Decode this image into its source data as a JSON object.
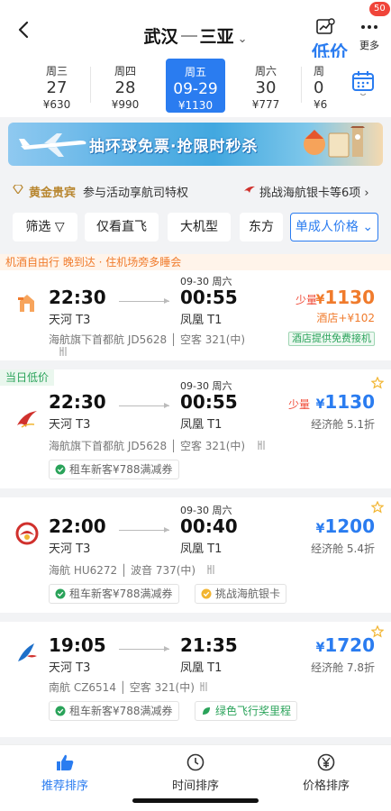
{
  "header": {
    "origin": "武汉",
    "destination": "三亚",
    "price_alert_label": "低价提醒",
    "more_label": "更多",
    "badge_count": "50"
  },
  "dates": [
    {
      "weekday": "周三",
      "day": "27",
      "price": "¥630"
    },
    {
      "weekday": "周四",
      "day": "28",
      "price": "¥990"
    },
    {
      "weekday": "周五",
      "day": "09-29",
      "price": "¥1130",
      "selected": true
    },
    {
      "weekday": "周六",
      "day": "30",
      "price": "¥777"
    },
    {
      "weekday": "周",
      "day": "0",
      "price": "¥6"
    }
  ],
  "banner": {
    "text": "抽环球免票·抢限时秒杀"
  },
  "vip": {
    "tier": "黄金贵宾",
    "activity": "参与活动享航司特权",
    "challenge": "挑战海航银卡等6项"
  },
  "filters": [
    {
      "label": "筛选"
    },
    {
      "label": "仅看直飞"
    },
    {
      "label": "大机型"
    },
    {
      "label": "东方航"
    },
    {
      "label": "单成人价格"
    }
  ],
  "flights": [
    {
      "tag": "机酒自由行  晚到达 · 住机场旁多睡会",
      "dep_time": "22:30",
      "dep_airport": "天河 T3",
      "arr_time": "00:55",
      "arr_airport": "凤凰 T1",
      "arr_date": "09-30 周六",
      "info": "海航旗下首都航 JD5628 │ 空客 321(中)",
      "few_label": "少量",
      "price": "1130",
      "hotel_plus": "酒店+¥102",
      "pickup": "酒店提供免费接机",
      "style": "orange"
    },
    {
      "tag": "当日低价",
      "dep_time": "22:30",
      "dep_airport": "天河 T3",
      "arr_time": "00:55",
      "arr_airport": "凤凰 T1",
      "arr_date": "09-30 周六",
      "info": "海航旗下首都航 JD5628 │ 空客 321(中)",
      "few_label": "少量",
      "price": "1130",
      "cabin": "经济舱 5.1折",
      "coupons": [
        "租车新客¥788满减券"
      ]
    },
    {
      "dep_time": "22:00",
      "dep_airport": "天河 T3",
      "arr_time": "00:40",
      "arr_airport": "凤凰 T1",
      "arr_date": "09-30 周六",
      "info": "海航 HU6272 │ 波音 737(中)",
      "price": "1200",
      "cabin": "经济舱 5.4折",
      "coupons": [
        "租车新客¥788满减券",
        "挑战海航银卡"
      ]
    },
    {
      "dep_time": "19:05",
      "dep_airport": "天河 T3",
      "arr_time": "21:35",
      "arr_airport": "凤凰 T1",
      "info": "南航 CZ6514 │ 空客 321(中)",
      "price": "1720",
      "cabin": "经济舱 7.8折",
      "coupons": [
        "租车新客¥788满减券",
        "绿色飞行奖里程"
      ]
    }
  ],
  "bottom_nav": [
    {
      "label": "推荐排序",
      "active": true
    },
    {
      "label": "时间排序"
    },
    {
      "label": "价格排序"
    }
  ],
  "colors": {
    "accent": "#2a7cf0",
    "orange": "#f07b2c",
    "red": "#f04c3a",
    "green": "#2aa35a",
    "gold": "#b8862f"
  }
}
